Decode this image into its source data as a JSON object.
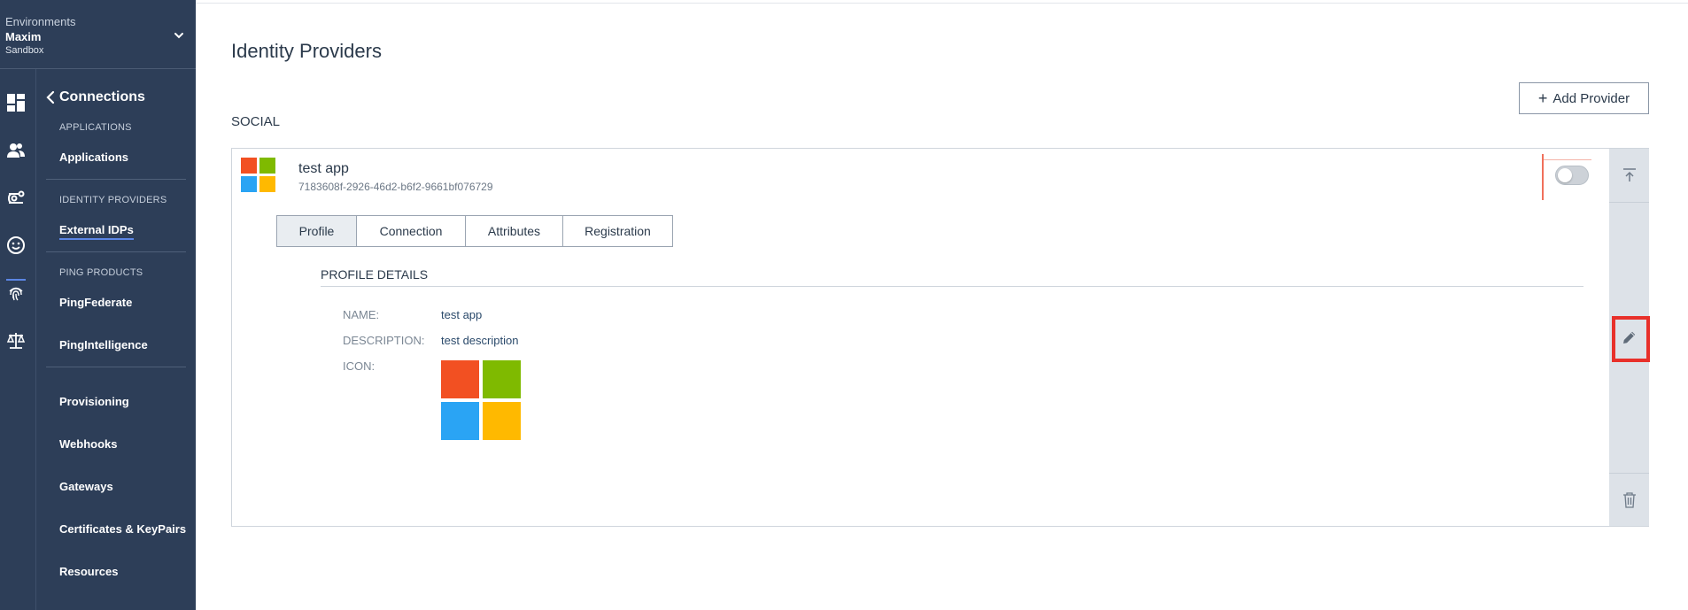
{
  "environment": {
    "caption": "Environments",
    "name": "Maxim",
    "type": "Sandbox"
  },
  "rail_icons": [
    "dashboard-icon",
    "users-icon",
    "connections-icon",
    "experiences-icon",
    "fingerprint-icon",
    "scale-icon"
  ],
  "nav": {
    "title": "Connections",
    "sections": [
      {
        "label": "APPLICATIONS",
        "items": [
          "Applications"
        ]
      },
      {
        "label": "IDENTITY PROVIDERS",
        "items": [
          "External IDPs"
        ]
      },
      {
        "label": "PING PRODUCTS",
        "items": [
          "PingFederate",
          "PingIntelligence"
        ]
      }
    ],
    "more_items": [
      "Provisioning",
      "Webhooks",
      "Gateways",
      "Certificates & KeyPairs",
      "Resources"
    ],
    "active_item": "External IDPs"
  },
  "page": {
    "title": "Identity Providers",
    "add_button": "Add Provider",
    "section": "SOCIAL"
  },
  "provider": {
    "name": "test app",
    "id": "7183608f-2926-46d2-b6f2-9661bf076729",
    "enabled": false,
    "tabs": [
      "Profile",
      "Connection",
      "Attributes",
      "Registration"
    ],
    "active_tab": "Profile",
    "details_title": "PROFILE DETAILS",
    "fields": {
      "name_label": "NAME:",
      "name_value": "test app",
      "description_label": "DESCRIPTION:",
      "description_value": "test description",
      "icon_label": "ICON:"
    }
  },
  "colors": {
    "sidebar": "#2d3e58",
    "accent": "#5b86e5",
    "ms_red": "#f25022",
    "ms_green": "#7fba00",
    "ms_blue": "#2aa4f4",
    "ms_yellow": "#ffb900",
    "highlight": "#e8302a"
  }
}
